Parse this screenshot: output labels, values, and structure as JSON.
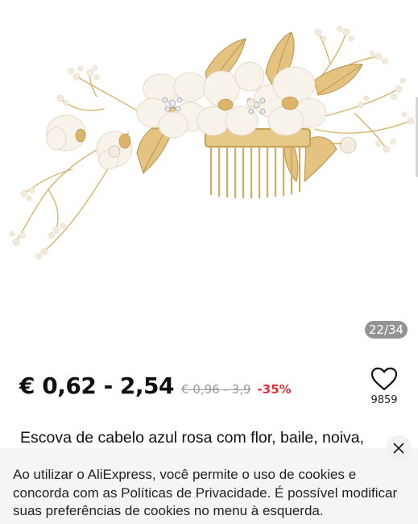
{
  "gallery": {
    "counter": "22/34",
    "image_icon": "hair-comb-product-photo"
  },
  "price": {
    "range": "€ 0,62 - 2,54",
    "original": "€ 0,96 - 3,9",
    "discount": "-35%"
  },
  "wishlist": {
    "icon": "heart-icon",
    "count": "9859"
  },
  "product": {
    "title": "Escova de cabelo azul rosa com flor, baile, noiva,"
  },
  "cookie_banner": {
    "text": "Ao utilizar o AliExpress, você permite o uso de cookies e concorda com as Políticas de Privacidade. É possível modificar suas preferências de cookies no menu à esquerda.",
    "close_icon": "close-icon"
  },
  "colors": {
    "discount": "#e0313a",
    "gold": "#d6b068",
    "ivory": "#f7f1e6"
  }
}
